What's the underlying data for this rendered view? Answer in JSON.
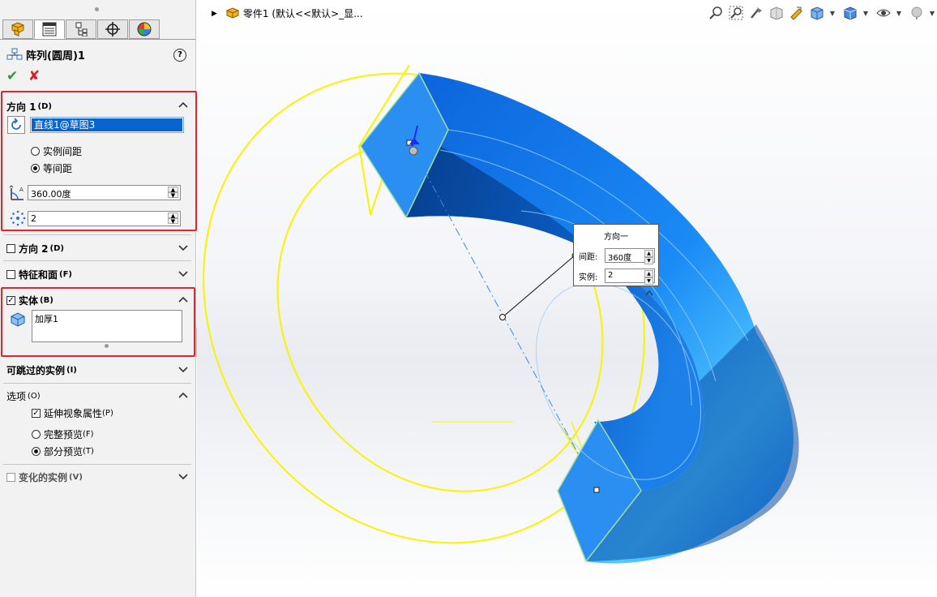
{
  "feature": {
    "title": "阵列(圆周)1",
    "help_label": "?",
    "ok_label": "✔",
    "cancel_label": "✘"
  },
  "tabs": [
    {
      "icon": "feature-manager-icon"
    },
    {
      "icon": "property-manager-icon"
    },
    {
      "icon": "configuration-manager-icon"
    },
    {
      "icon": "dimxpert-manager-icon"
    },
    {
      "icon": "display-manager-icon"
    }
  ],
  "direction1": {
    "label": "方向 1",
    "shortcut": "(D)",
    "axis_value": "直线1@草图3",
    "option_instance_spacing": "实例间距",
    "option_equal_spacing": "等间距",
    "selected": "equal_spacing",
    "angle_value": "360.00度",
    "count_value": "2"
  },
  "direction2": {
    "label": "方向 2",
    "shortcut": "(D)",
    "checked": false
  },
  "features_faces": {
    "label": "特征和面",
    "shortcut": "(F)",
    "checked": false
  },
  "bodies": {
    "label": "实体",
    "shortcut": "(B)",
    "checked": true,
    "list": [
      "加厚1"
    ]
  },
  "skip_instances": {
    "label": "可跳过的实例",
    "shortcut": "(I)"
  },
  "options": {
    "label": "选项",
    "shortcut": "(O)",
    "propagate_visual": "延伸视象属性",
    "propagate_shortcut": "(P)",
    "propagate_checked": true,
    "full_preview": "完整预览",
    "full_shortcut": "(F)",
    "partial_preview": "部分预览",
    "partial_shortcut": "(T)",
    "preview_selected": "partial"
  },
  "varied_instances": {
    "label": "变化的实例",
    "shortcut": "(V)",
    "checked": false
  },
  "tree": {
    "label": "零件1 (默认<<默认>_显..."
  },
  "callout": {
    "title": "方向一",
    "spacing_label": "间距:",
    "spacing_value": "360度",
    "instances_label": "实例:",
    "instances_value": "2"
  },
  "colors": {
    "highlight_red": "#e4232b",
    "body_blue": "#1e86f0",
    "preview_yellow": "#f5f500",
    "selection_blue": "#0a64d0"
  }
}
